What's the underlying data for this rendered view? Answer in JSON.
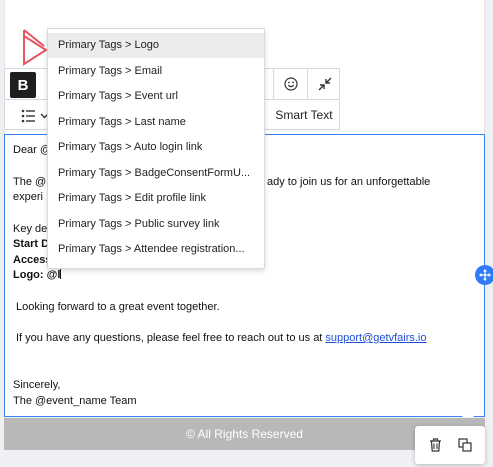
{
  "toolbar": {
    "bold_label": "B",
    "smart_text_label": "Smart Text",
    "emoji_icon": "emoji-icon",
    "collapse_icon": "collapse-arrows-icon",
    "list_icon": "bulleted-list-icon"
  },
  "dropdown": {
    "items": [
      {
        "label": "Primary Tags > Logo",
        "active": true
      },
      {
        "label": "Primary Tags > Email",
        "active": false
      },
      {
        "label": "Primary Tags > Event url",
        "active": false
      },
      {
        "label": "Primary Tags > Last name",
        "active": false
      },
      {
        "label": "Primary Tags > Auto login link",
        "active": false
      },
      {
        "label": "Primary Tags > BadgeConsentFormU...",
        "active": false
      },
      {
        "label": "Primary Tags > Edit profile link",
        "active": false
      },
      {
        "label": "Primary Tags > Public survey link",
        "active": false
      },
      {
        "label": "Primary Tags > Attendee registration...",
        "active": false
      }
    ]
  },
  "editor": {
    "greeting": "Dear @",
    "intro_start": "The @",
    "intro_end": "ady to join us for an unforgettable",
    "intro_cont": "experi",
    "key_details": "Key de",
    "start_label": "Start D",
    "access_label": "Access",
    "logo_label": "Logo: @l",
    "looking_forward": "Looking forward to a great event together.",
    "questions_text": "If you have any questions, please feel free to reach out to us at ",
    "support_email": "support@getvfairs.io",
    "sincerely": "Sincerely,",
    "signature": "The @event_name Team"
  },
  "footer": {
    "copyright": "© All Rights Reserved"
  },
  "colors": {
    "accent": "#2f7cf6",
    "editor_border": "#3b82f6",
    "footer_bg": "#b8b8b8",
    "logo": "#e8555f"
  }
}
